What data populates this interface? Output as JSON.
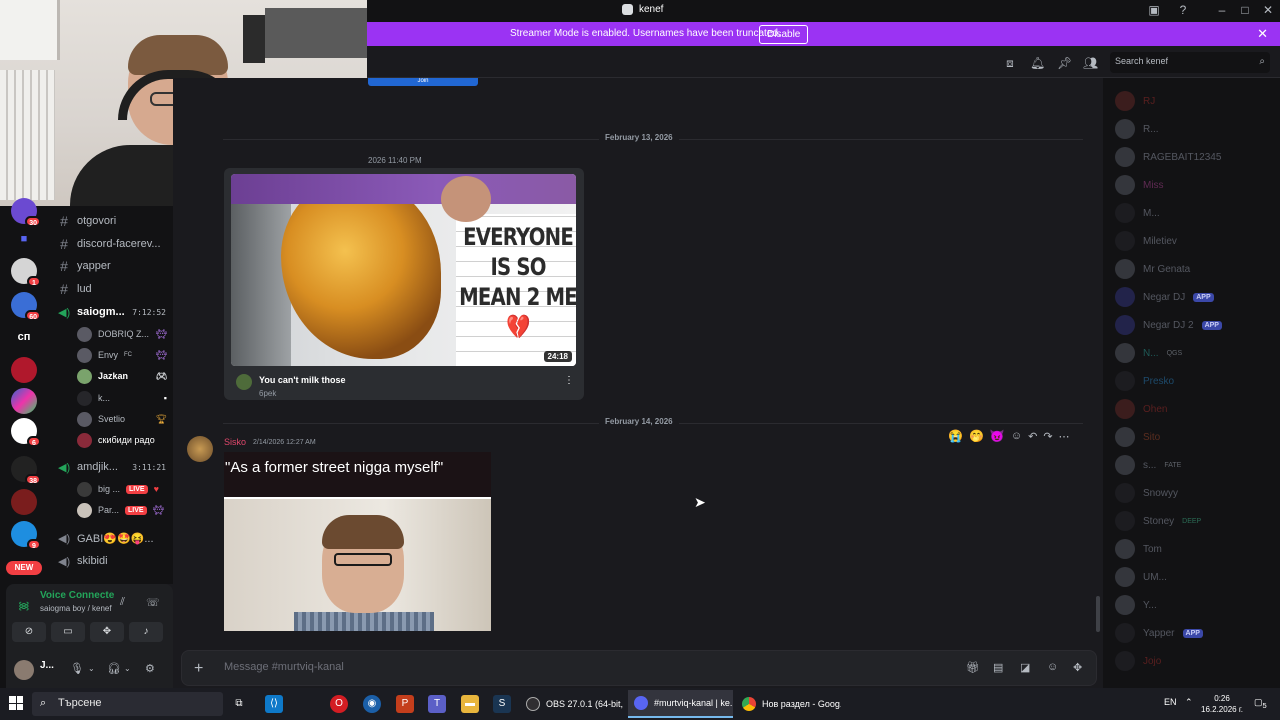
{
  "titlebar": {
    "title": "kenef"
  },
  "streamer": {
    "text": "Streamer Mode is enabled. Usernames have been truncated.",
    "disable_label": "Disable"
  },
  "header": {
    "search_placeholder": "Search kenef"
  },
  "servers": {
    "badges": [
      "30",
      "1",
      "60",
      "6",
      "38",
      "9"
    ],
    "text_server": "сп",
    "new_label": "NEW"
  },
  "channels": {
    "text": [
      "otgovori",
      "discord-facerev...",
      "yapper",
      "lud"
    ],
    "voice1": {
      "name": "saiogm...",
      "timer": "7:12:52"
    },
    "voice1_users": [
      "DOBRIQ Z...",
      "Envy",
      "Jazkan",
      "k...",
      "Svetlio",
      "скибиди радо"
    ],
    "envy_tag": "FC",
    "voice2": {
      "name": "amdjik...",
      "timer": "3:11:21"
    },
    "voice2_users": [
      "big ...",
      "Par..."
    ],
    "live_label": "LIVE",
    "voice3": "GABI😍🤩😝...",
    "voice4": "skibidi"
  },
  "voicepanel": {
    "title": "Voice Connecte",
    "subtitle": "saiogma boy / kenef"
  },
  "userarea": {
    "name": "J..."
  },
  "chat": {
    "top_button": "Join",
    "date1": "February 13, 2026",
    "timestamp_partial": "2026 11:40 PM",
    "embed": {
      "meme_text": "EVERYONE IS SO MEAN 2 ME",
      "heart": "💔",
      "duration": "24:18",
      "title": "You can't milk those",
      "channel": "6pek"
    },
    "date2": "February 14, 2026",
    "message": {
      "author": "Sisko",
      "time": "2/14/2026 12:27 AM",
      "caption": "\"As a former street nigga myself\""
    },
    "reactions": [
      "😭",
      "🤭",
      "😈"
    ]
  },
  "composer": {
    "placeholder": "Message #murtviq-kanal"
  },
  "members": [
    {
      "name": "RJ"
    },
    {
      "name": "R..."
    },
    {
      "name": "RAGEBAIT12345"
    },
    {
      "name": "Miss"
    },
    {
      "name": "M..."
    },
    {
      "name": "Miletiev"
    },
    {
      "name": "Mr Genata"
    },
    {
      "name": "Negar DJ",
      "tag": "APP"
    },
    {
      "name": "Negar DJ 2",
      "tag": "APP"
    },
    {
      "name": "N...",
      "tag": "QGS"
    },
    {
      "name": "Presko"
    },
    {
      "name": "Ohen"
    },
    {
      "name": "Sito"
    },
    {
      "name": "s...",
      "tag": "FATE"
    },
    {
      "name": "Snowyy"
    },
    {
      "name": "Stoney",
      "tag": "DEEP"
    },
    {
      "name": "Tom"
    },
    {
      "name": "UM..."
    },
    {
      "name": "Y..."
    },
    {
      "name": "Yapper",
      "tag": "APP"
    },
    {
      "name": "Jojo"
    }
  ],
  "taskbar": {
    "search_placeholder": "Търсене",
    "tasks": [
      "OBS 27.0.1 (64-bit, ...",
      "#murtviq-kanal | ke...",
      "Нов раздел - Goog..."
    ],
    "lang": "EN",
    "time": "0:26",
    "date": "16.2.2026 г.",
    "notif_count": "5"
  }
}
